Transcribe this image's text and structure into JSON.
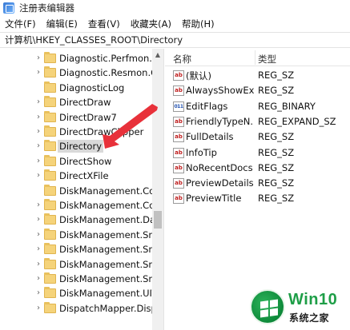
{
  "window": {
    "title": "注册表编辑器",
    "icon": "registry-editor-icon"
  },
  "menu": [
    "文件(F)",
    "编辑(E)",
    "查看(V)",
    "收藏夹(A)",
    "帮助(H)"
  ],
  "address": "计算机\\HKEY_CLASSES_ROOT\\Directory",
  "tree": {
    "items": [
      {
        "label": "Diagnostic.Perfmon.D",
        "expandable": true
      },
      {
        "label": "Diagnostic.Resmon.C",
        "expandable": true
      },
      {
        "label": "DiagnosticLog",
        "expandable": false
      },
      {
        "label": "DirectDraw",
        "expandable": true
      },
      {
        "label": "DirectDraw7",
        "expandable": true
      },
      {
        "label": "DirectDrawClipper",
        "expandable": true
      },
      {
        "label": "Directory",
        "expandable": true,
        "selected": true
      },
      {
        "label": "DirectShow",
        "expandable": true
      },
      {
        "label": "DirectXFile",
        "expandable": true
      },
      {
        "label": "DiskManagement.Cor",
        "expandable": false
      },
      {
        "label": "DiskManagement.Cor",
        "expandable": true
      },
      {
        "label": "DiskManagement.Dat",
        "expandable": true
      },
      {
        "label": "DiskManagement.Sna",
        "expandable": true
      },
      {
        "label": "DiskManagement.Sna",
        "expandable": true
      },
      {
        "label": "DiskManagement.Sna",
        "expandable": true
      },
      {
        "label": "DiskManagement.Sna",
        "expandable": true
      },
      {
        "label": "DiskManagement.UIT",
        "expandable": true
      },
      {
        "label": "DispatchMapper.Disp",
        "expandable": true
      }
    ]
  },
  "list": {
    "headers": {
      "name": "名称",
      "type": "类型"
    },
    "rows": [
      {
        "name": "(默认)",
        "type": "REG_SZ",
        "icon": "ab-string-icon"
      },
      {
        "name": "AlwaysShowExt",
        "type": "REG_SZ",
        "icon": "ab-string-icon"
      },
      {
        "name": "EditFlags",
        "type": "REG_BINARY",
        "icon": "binary-value-icon"
      },
      {
        "name": "FriendlyTypeN...",
        "type": "REG_EXPAND_SZ",
        "icon": "ab-string-icon"
      },
      {
        "name": "FullDetails",
        "type": "REG_SZ",
        "icon": "ab-string-icon"
      },
      {
        "name": "InfoTip",
        "type": "REG_SZ",
        "icon": "ab-string-icon"
      },
      {
        "name": "NoRecentDocs",
        "type": "REG_SZ",
        "icon": "ab-string-icon"
      },
      {
        "name": "PreviewDetails",
        "type": "REG_SZ",
        "icon": "ab-string-icon"
      },
      {
        "name": "PreviewTitle",
        "type": "REG_SZ",
        "icon": "ab-string-icon"
      }
    ]
  },
  "watermark": {
    "brand": "Win10",
    "subtitle": "系统之家"
  },
  "colors": {
    "annotation_arrow": "#e8313a",
    "folder": "#f5d37a",
    "watermark_green": "#1e9e47",
    "selection": "#d9d9d9"
  }
}
